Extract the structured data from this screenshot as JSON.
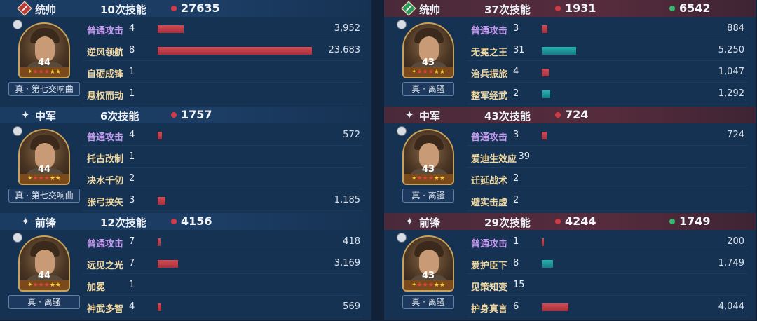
{
  "left": {
    "blocks": [
      {
        "role": "统帅",
        "times": "10次技能",
        "damage": "27635",
        "heal": null,
        "hero": {
          "level": "44",
          "tactic": "真 · 第七交响曲",
          "star_rating": 5,
          "red_stars": 3
        },
        "skills": [
          {
            "name": "普通攻击",
            "type": "normal",
            "count": "4",
            "bar": "red",
            "fraction": 0.17,
            "value": "3,952"
          },
          {
            "name": "逆风领航",
            "type": "skill",
            "count": "8",
            "bar": "red",
            "fraction": 1.0,
            "value": "23,683"
          },
          {
            "name": "自砺成锋",
            "type": "skill",
            "count": "1",
            "bar": null,
            "fraction": 0,
            "value": ""
          },
          {
            "name": "悬权而动",
            "type": "skill",
            "count": "1",
            "bar": null,
            "fraction": 0,
            "value": ""
          }
        ]
      },
      {
        "role": "中军",
        "times": "6次技能",
        "damage": "1757",
        "heal": null,
        "hero": {
          "level": "44",
          "tactic": "真 · 第七交响曲",
          "star_rating": 5,
          "red_stars": 3
        },
        "skills": [
          {
            "name": "普通攻击",
            "type": "normal",
            "count": "4",
            "bar": "red",
            "fraction": 0.025,
            "value": "572"
          },
          {
            "name": "托古改制",
            "type": "skill",
            "count": "1",
            "bar": null,
            "fraction": 0,
            "value": ""
          },
          {
            "name": "决水千仞",
            "type": "skill",
            "count": "2",
            "bar": null,
            "fraction": 0,
            "value": ""
          },
          {
            "name": "张弓挟矢",
            "type": "skill",
            "count": "3",
            "bar": "red",
            "fraction": 0.05,
            "value": "1,185"
          }
        ]
      },
      {
        "role": "前锋",
        "times": "12次技能",
        "damage": "4156",
        "heal": null,
        "hero": {
          "level": "44",
          "tactic": "真 · 离骚",
          "star_rating": 5,
          "red_stars": 3
        },
        "skills": [
          {
            "name": "普通攻击",
            "type": "normal",
            "count": "7",
            "bar": "red",
            "fraction": 0.018,
            "value": "418"
          },
          {
            "name": "远见之光",
            "type": "skill",
            "count": "7",
            "bar": "red",
            "fraction": 0.134,
            "value": "3,169"
          },
          {
            "name": "加冕",
            "type": "skill",
            "count": "1",
            "bar": null,
            "fraction": 0,
            "value": ""
          },
          {
            "name": "神武多智",
            "type": "skill",
            "count": "4",
            "bar": "red",
            "fraction": 0.024,
            "value": "569"
          }
        ]
      }
    ]
  },
  "right": {
    "blocks": [
      {
        "role": "统帅",
        "times": "37次技能",
        "damage": "1931",
        "heal": "6542",
        "hero": {
          "level": "43",
          "tactic": "真 · 离骚",
          "star_rating": 5,
          "red_stars": 3
        },
        "skills": [
          {
            "name": "普通攻击",
            "type": "normal",
            "count": "3",
            "bar": "red",
            "fraction": 0.037,
            "value": "884"
          },
          {
            "name": "无冕之王",
            "type": "skill",
            "count": "31",
            "bar": "teal",
            "fraction": 0.222,
            "value": "5,250"
          },
          {
            "name": "治兵振旅",
            "type": "skill",
            "count": "4",
            "bar": "red",
            "fraction": 0.044,
            "value": "1,047"
          },
          {
            "name": "整军经武",
            "type": "skill",
            "count": "2",
            "bar": "teal",
            "fraction": 0.055,
            "value": "1,292"
          }
        ]
      },
      {
        "role": "中军",
        "times": "43次技能",
        "damage": "724",
        "heal": null,
        "hero": {
          "level": "43",
          "tactic": "真 · 离骚",
          "star_rating": 5,
          "red_stars": 3
        },
        "skills": [
          {
            "name": "普通攻击",
            "type": "normal",
            "count": "3",
            "bar": "red",
            "fraction": 0.031,
            "value": "724"
          },
          {
            "name": "爱迪生效应",
            "type": "skill",
            "count": "39",
            "bar": null,
            "fraction": 0,
            "value": ""
          },
          {
            "name": "迁延战术",
            "type": "skill",
            "count": "2",
            "bar": null,
            "fraction": 0,
            "value": ""
          },
          {
            "name": "避实击虚",
            "type": "skill",
            "count": "2",
            "bar": null,
            "fraction": 0,
            "value": ""
          }
        ]
      },
      {
        "role": "前锋",
        "times": "29次技能",
        "damage": "4244",
        "heal": "1749",
        "hero": {
          "level": "43",
          "tactic": "真 · 离骚",
          "star_rating": 5,
          "red_stars": 3
        },
        "skills": [
          {
            "name": "普通攻击",
            "type": "normal",
            "count": "1",
            "bar": "red",
            "fraction": 0.008,
            "value": "200"
          },
          {
            "name": "爱护臣下",
            "type": "skill",
            "count": "8",
            "bar": "teal",
            "fraction": 0.074,
            "value": "1,749"
          },
          {
            "name": "见策知变",
            "type": "skill",
            "count": "15",
            "bar": null,
            "fraction": 0,
            "value": ""
          },
          {
            "name": "护身真言",
            "type": "skill",
            "count": "6",
            "bar": "red",
            "fraction": 0.171,
            "value": "4,044"
          }
        ]
      }
    ]
  },
  "colors": {
    "damage_dot": "#d23c48",
    "heal_dot": "#35b86a",
    "damage_bar": "#c23e48",
    "heal_bar": "#1f9ea0"
  },
  "icons": {
    "left_commander": "red-diamond-emblem-icon",
    "right_commander": "green-diamond-emblem-icon",
    "other_roles": "sparkle-icon"
  }
}
